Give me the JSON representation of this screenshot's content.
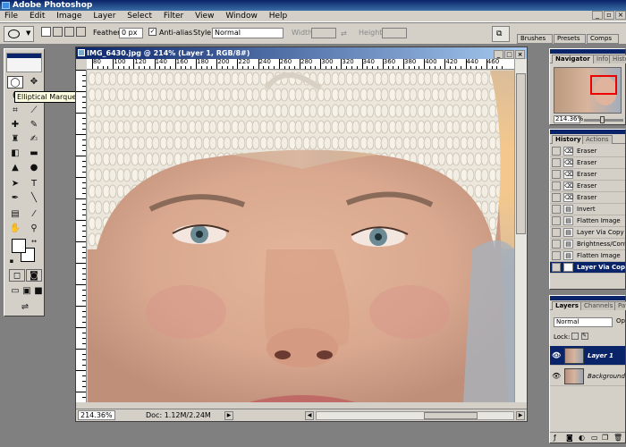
{
  "app": {
    "title": "Adobe Photoshop"
  },
  "menu": [
    "File",
    "Edit",
    "Image",
    "Layer",
    "Select",
    "Filter",
    "View",
    "Window",
    "Help"
  ],
  "options_bar": {
    "feather_label": "Feather:",
    "feather_value": "0 px",
    "antialias_label": "Anti-alias",
    "style_label": "Style:",
    "style_value": "Normal",
    "width_label": "Width:",
    "height_label": "Height:"
  },
  "palette_well": {
    "tabs": [
      "Brushes",
      "Presets",
      "Comps"
    ]
  },
  "tooltip": "Elliptical Marquee Tool (M)",
  "document": {
    "title": "IMG_6430.jpg @ 214% (Layer 1, RGB/8#)",
    "ruler_top": [
      "80",
      "100",
      "120",
      "140",
      "160",
      "180",
      "200",
      "220",
      "240",
      "260",
      "280",
      "300",
      "320",
      "340",
      "360",
      "380",
      "400",
      "420",
      "440",
      "460"
    ],
    "zoom": "214.36%",
    "doc_size": "Doc: 1.12M/2.24M"
  },
  "navigator": {
    "tabs": [
      "Navigator",
      "Info",
      "Histo"
    ],
    "zoom": "214.36%"
  },
  "history": {
    "tabs": [
      "History",
      "Actions"
    ],
    "items": [
      "Eraser",
      "Eraser",
      "Eraser",
      "Eraser",
      "Eraser",
      "Invert",
      "Flatten Image",
      "Layer Via Copy",
      "Brightness/Cont",
      "Flatten Image",
      "Layer Via Copy"
    ]
  },
  "layers": {
    "tabs": [
      "Layers",
      "Channels",
      "Paths"
    ],
    "blend_mode": "Normal",
    "opacity_label": "Op",
    "lock_label": "Lock:",
    "items": [
      "Layer 1",
      "Background"
    ]
  },
  "colors": {
    "title_blue": "#0a246a",
    "chrome": "#d4d0c8"
  }
}
